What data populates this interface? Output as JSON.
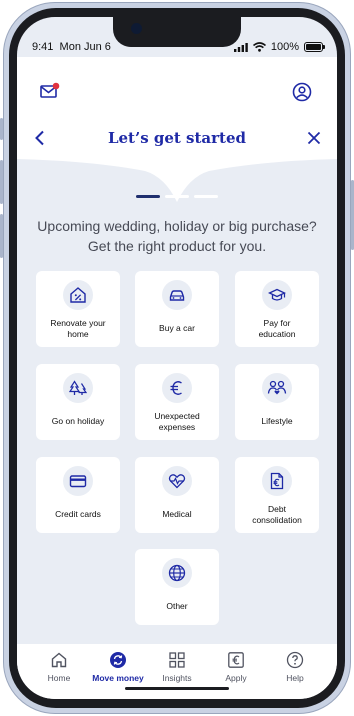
{
  "status_bar": {
    "time": "9:41",
    "date": "Mon Jun 6",
    "battery": "100%"
  },
  "header": {
    "title": "Let’s get started",
    "back_icon": "chevron-left-icon",
    "close_icon": "close-icon",
    "mail_icon": "mail-icon",
    "profile_icon": "profile-icon"
  },
  "progress": {
    "steps": 3,
    "current": 1
  },
  "intro": {
    "line1": "Upcoming wedding, holiday or big purchase?",
    "line2": "Get the right product for you."
  },
  "options": [
    {
      "line1": "Renovate your",
      "line2": "home",
      "icon": "house-percent-icon"
    },
    {
      "line1": "Buy a car",
      "line2": "",
      "icon": "car-icon"
    },
    {
      "line1": "Pay for",
      "line2": "education",
      "icon": "graduation-cap-icon"
    },
    {
      "line1": "Go on holiday",
      "line2": "",
      "icon": "trees-icon"
    },
    {
      "line1": "Unexpected",
      "line2": "expenses",
      "icon": "euro-icon"
    },
    {
      "line1": "Lifestyle",
      "line2": "",
      "icon": "people-icon"
    },
    {
      "line1": "Credit cards",
      "line2": "",
      "icon": "credit-card-icon"
    },
    {
      "line1": "Medical",
      "line2": "",
      "icon": "heart-pulse-icon"
    },
    {
      "line1": "Debt",
      "line2": "consolidation",
      "icon": "euro-document-icon"
    },
    {
      "line1": "Other",
      "line2": "",
      "icon": "globe-icon"
    }
  ],
  "tabs": [
    {
      "label": "Home",
      "icon": "home-icon"
    },
    {
      "label": "Move money",
      "icon": "transfer-icon"
    },
    {
      "label": "Insights",
      "icon": "grid-icon"
    },
    {
      "label": "Apply",
      "icon": "euro-square-icon"
    },
    {
      "label": "Help",
      "icon": "help-icon"
    }
  ],
  "active_tab": "Move money",
  "colors": {
    "brand_blue": "#1f2aa6",
    "background": "#e9edf4",
    "notification": "#e0323f"
  }
}
